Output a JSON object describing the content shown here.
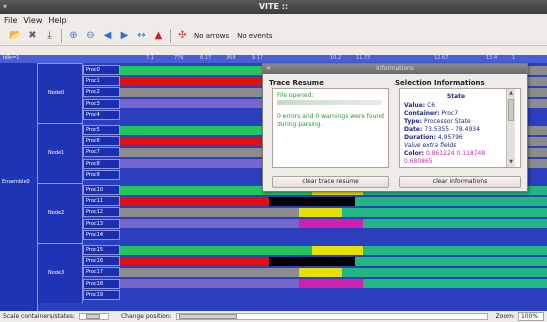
{
  "window": {
    "title": "VITE ::",
    "icon": "window-menu-icon"
  },
  "menu": [
    {
      "label": "File"
    },
    {
      "label": "View"
    },
    {
      "label": "Help"
    }
  ],
  "toolbar": {
    "icons": [
      "open-folder-icon",
      "close-x-icon",
      "save-export-icon",
      "zoom-in-icon",
      "zoom-out-icon",
      "arrow-left-icon",
      "arrow-right-icon",
      "fit-width-icon",
      "up-arrow-icon",
      "settings-plugin-icon"
    ],
    "arrows_label": "No arrows",
    "events_label": "No events"
  },
  "trace": {
    "ruler_left": "Idle=1",
    "ruler_ticks": [
      "7.1",
      "776",
      "8.17",
      "368",
      "9.17",
      "10.2",
      "11.73",
      "12.67",
      "13.4",
      "1"
    ],
    "environment": "Ensemble0",
    "nodes": [
      {
        "name": "Node0",
        "procs": [
          "Proc0",
          "Proc1",
          "Proc2",
          "Proc3",
          "Proc4"
        ]
      },
      {
        "name": "Node1",
        "procs": [
          "Proc5",
          "Proc6",
          "Proc7",
          "Proc8",
          "Proc9"
        ]
      },
      {
        "name": "Node2",
        "procs": [
          "Proc10",
          "Proc11",
          "Proc12",
          "Proc13",
          "Proc14"
        ]
      },
      {
        "name": "Node3",
        "procs": [
          "Proc15",
          "Proc16",
          "Proc17",
          "Proc18",
          "Proc19"
        ]
      }
    ]
  },
  "dialog": {
    "title": "Informations",
    "trace_resume": {
      "heading": "Trace Resume",
      "file_opened": "File opened:",
      "message_line1": "0 errors and 0 warnings were found",
      "message_line2": "during parsing.",
      "button": "clear trace resume"
    },
    "selection": {
      "heading": "Selection Informations",
      "state_title": "State",
      "value_label": "Value:",
      "value": "C6",
      "container_label": "Container:",
      "container": "Proc7",
      "type_label": "Type:",
      "type": "Processor State",
      "date_label": "Date:",
      "date": "73.5355 - 78.4934",
      "duration_label": "Duration:",
      "duration": "4.95796",
      "extra_fields": "Value extra fields",
      "color_label": "Color:",
      "color_value_line1": "0.861224 0.118748",
      "color_value_line2": "0.680865",
      "button": "clear informations"
    }
  },
  "statusbar": {
    "scale_label": "Scale containers/states:",
    "position_label": "Change position:",
    "zoom_label": "Zoom:",
    "zoom_value": "100%"
  },
  "colors": {
    "trace_bg": "#2b3fbf",
    "state_green": "#22c55e",
    "state_red": "#e01010",
    "state_yellow": "#e6e000",
    "state_magenta": "#d020b0",
    "state_grey": "#8c8c8c",
    "state_purple": "#7766cc",
    "state_teal": "#20b880",
    "state_black": "#000000"
  }
}
